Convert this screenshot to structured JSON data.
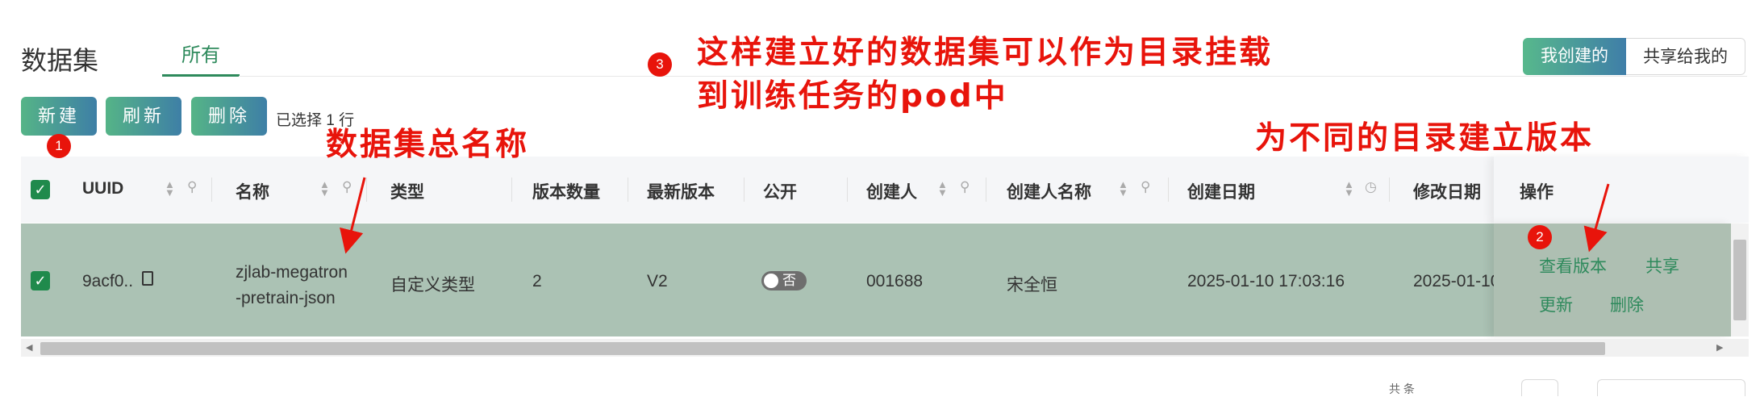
{
  "header": {
    "title": "数据集",
    "tabs": [
      {
        "label": "所有"
      }
    ],
    "segment": {
      "mine": "我创建的",
      "shared": "共享给我的"
    }
  },
  "toolbar": {
    "new_label": "新建",
    "refresh_label": "刷新",
    "delete_label": "删除",
    "selected_text": "已选择 1 行"
  },
  "annotations": {
    "marker_1": "1",
    "marker_2": "2",
    "marker_3": "3",
    "note_3_line1": "这样建立好的数据集可以作为目录挂载",
    "note_3_line2": "到训练任务的pod中",
    "note_name": "数据集总名称",
    "note_versions": "为不同的目录建立版本"
  },
  "table": {
    "columns": [
      "UUID",
      "名称",
      "类型",
      "版本数量",
      "最新版本",
      "公开",
      "创建人",
      "创建人名称",
      "创建日期",
      "修改日期",
      "操作"
    ],
    "rows": [
      {
        "uuid": "9acf0..",
        "name_line1": "zjlab-megatron",
        "name_line2": "-pretrain-json",
        "type": "自定义类型",
        "version_count": "2",
        "latest_version": "V2",
        "public_label": "否",
        "public": false,
        "creator": "001688",
        "creator_name": "宋全恒",
        "created_at": "2025-01-10 17:03:16",
        "modified_at": "2025-01-10",
        "actions": {
          "view_versions": "查看版本",
          "share": "共享",
          "update": "更新",
          "delete": "删除"
        }
      }
    ]
  },
  "footer": {
    "partial_text": "共 条"
  },
  "colors": {
    "accent": "#2e8a5c",
    "selected_row": "#abc2b4",
    "annotation": "#e8140b",
    "gradient_start": "#55b487",
    "gradient_end": "#3e7fa6"
  }
}
